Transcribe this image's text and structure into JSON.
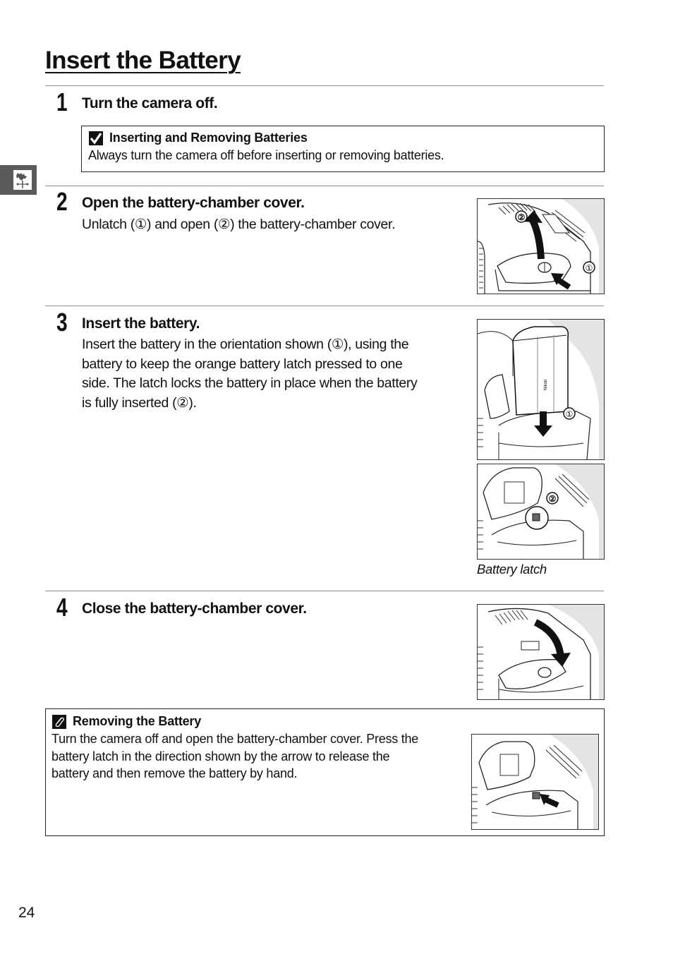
{
  "page": {
    "title": "Insert the Battery",
    "page_number": "24",
    "side_tab_icon": "weathervane-rooster-icon"
  },
  "steps": [
    {
      "number": "1",
      "heading": "Turn the camera off.",
      "body": ""
    },
    {
      "number": "2",
      "heading": "Open the battery-chamber cover.",
      "body": "Unlatch (①) and open (②) the battery-chamber cover.",
      "figure": {
        "callouts": [
          "②",
          "①"
        ],
        "description": "Camera base with battery-chamber cover being unlatched and opened"
      }
    },
    {
      "number": "3",
      "heading": "Insert the battery.",
      "body_lines": [
        "Insert the battery in the orientation shown (①), using the",
        "battery to keep the orange battery latch pressed to one",
        "side.  The latch locks the battery in place when the battery",
        "is fully inserted (②)."
      ],
      "figures": [
        {
          "callouts": [
            "①"
          ],
          "description": "Battery being inserted into chamber",
          "battery_label": "Nikon"
        },
        {
          "callouts": [
            "②"
          ],
          "description": "Battery latch locking battery in place"
        }
      ],
      "caption": "Battery latch"
    },
    {
      "number": "4",
      "heading": "Close the battery-chamber cover.",
      "body": "",
      "figure": {
        "description": "Battery-chamber cover being closed"
      }
    }
  ],
  "notes": {
    "inserting": {
      "icon": "checkmark-icon",
      "title": "Inserting and Removing Batteries",
      "text": "Always turn the camera off before inserting or removing batteries."
    },
    "removing": {
      "icon": "paperclip-icon",
      "title": "Removing the Battery",
      "text_lines": [
        "Turn the camera off and open the battery-chamber cover. Press the",
        "battery latch in the direction shown by the arrow to release the",
        "battery and then remove the battery by hand."
      ],
      "figure": {
        "description": "Battery latch being pressed to release battery"
      }
    }
  }
}
